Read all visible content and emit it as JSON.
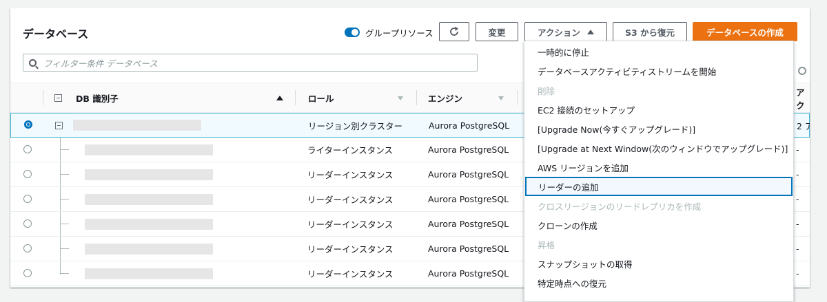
{
  "header": {
    "title": "データベース",
    "group_toggle_label": "グループリソース",
    "modify_label": "変更",
    "actions_label": "アクション",
    "restore_s3_label": "S3 から復元",
    "create_db_label": "データベースの作成"
  },
  "filter": {
    "placeholder": "フィルター条件 データベース"
  },
  "table": {
    "columns": [
      "DB 識別子",
      "ロール",
      "エンジン",
      "アク"
    ],
    "rows": [
      {
        "role": "リージョン別クラスター",
        "engine": "Aurora PostgreSQL",
        "extra": "2 ア"
      },
      {
        "role": "ライターインスタンス",
        "engine": "Aurora PostgreSQL",
        "extra": "-"
      },
      {
        "role": "リーダーインスタンス",
        "engine": "Aurora PostgreSQL",
        "extra": "-"
      },
      {
        "role": "リーダーインスタンス",
        "engine": "Aurora PostgreSQL",
        "extra": "-"
      },
      {
        "role": "リーダーインスタンス",
        "engine": "Aurora PostgreSQL",
        "extra": "-"
      },
      {
        "role": "リーダーインスタンス",
        "engine": "Aurora PostgreSQL",
        "extra": "-"
      },
      {
        "role": "リーダーインスタンス",
        "engine": "Aurora PostgreSQL",
        "extra": "-"
      }
    ]
  },
  "actions_menu": {
    "items": [
      {
        "label": "一時的に停止"
      },
      {
        "label": "データベースアクティビティストリームを開始"
      },
      {
        "label": "削除"
      },
      {
        "label": "EC2 接続のセットアップ"
      },
      {
        "label": "[Upgrade Now(今すぐアップグレード)]"
      },
      {
        "label": "[Upgrade at Next Window(次のウィンドウでアップグレード)]"
      },
      {
        "label": "AWS リージョンを追加"
      },
      {
        "label": "リーダーの追加"
      },
      {
        "label": "クロスリージョンのリードレプリカを作成"
      },
      {
        "label": "クローンの作成"
      },
      {
        "label": "昇格"
      },
      {
        "label": "スナップショットの取得"
      },
      {
        "label": "特定時点への復元"
      }
    ]
  },
  "colors": {
    "primary": "#ec7211",
    "accent": "#0073bb",
    "selected_row": "#f1faff"
  }
}
